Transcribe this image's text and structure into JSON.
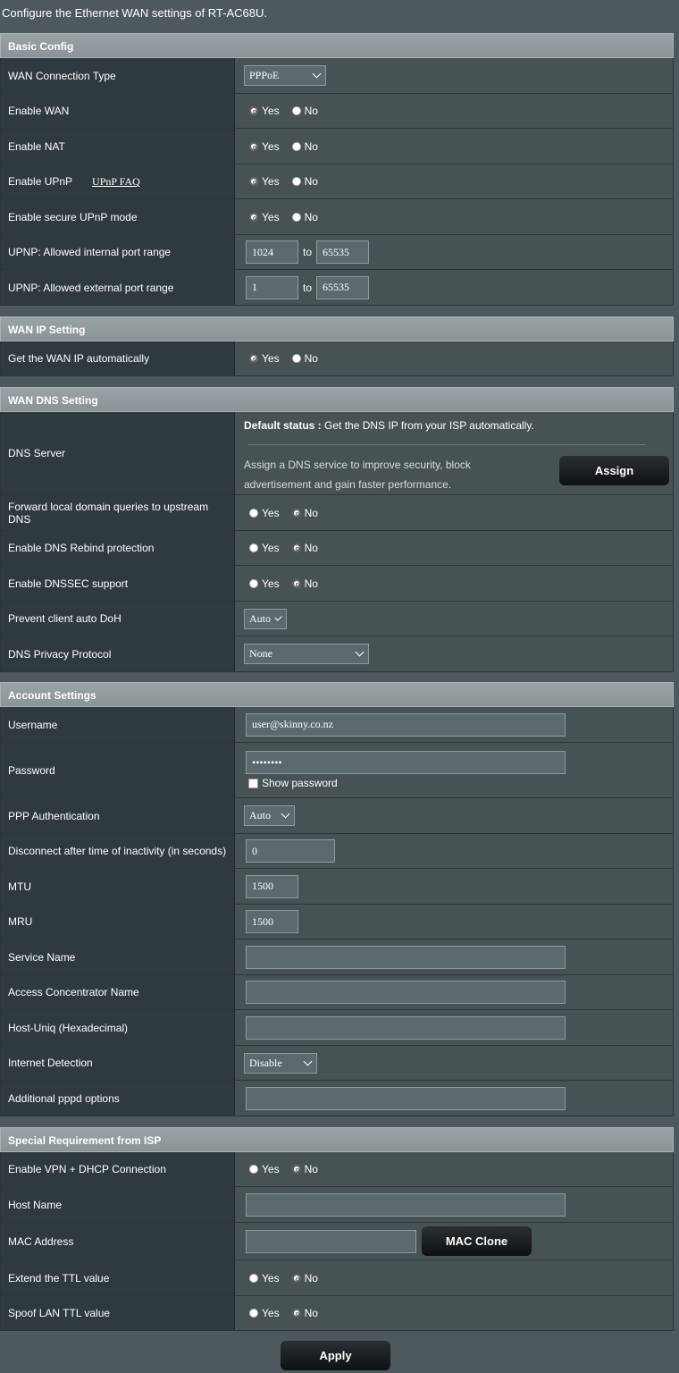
{
  "intro": "Configure the Ethernet WAN settings of RT-AC68U.",
  "yes": "Yes",
  "no": "No",
  "to": "to",
  "basic": {
    "title": "Basic Config",
    "wan_type_label": "WAN Connection Type",
    "wan_type_value": "PPPoE",
    "enable_wan_label": "Enable WAN",
    "enable_nat_label": "Enable NAT",
    "enable_upnp_label": "Enable UPnP",
    "upnp_faq": "UPnP FAQ",
    "secure_upnp_label": "Enable secure UPnP mode",
    "int_range_label": "UPNP: Allowed internal port range",
    "int_from": "1024",
    "int_to": "65535",
    "ext_range_label": "UPNP: Allowed external port range",
    "ext_from": "1",
    "ext_to": "65535"
  },
  "wanip": {
    "title": "WAN IP Setting",
    "auto_label": "Get the WAN IP automatically"
  },
  "dns": {
    "title": "WAN DNS Setting",
    "server_label": "DNS Server",
    "default_status_bold": "Default status :",
    "default_status_text": " Get the DNS IP from your ISP automatically.",
    "assign_text_1": "Assign a DNS service to improve security, block",
    "assign_text_2": "advertisement and gain faster performance.",
    "assign_button": "Assign",
    "forward_label_1": "Forward local domain queries to upstream",
    "forward_label_2": "DNS",
    "rebind_label": "Enable DNS Rebind protection",
    "dnssec_label": "Enable DNSSEC support",
    "doh_label": "Prevent client auto DoH",
    "doh_value": "Auto",
    "privacy_label": "DNS Privacy Protocol",
    "privacy_value": "None"
  },
  "account": {
    "title": "Account Settings",
    "username_label": "Username",
    "username_value": "user@skinny.co.nz",
    "password_label": "Password",
    "password_value": "••••••••",
    "show_password": "Show password",
    "ppp_auth_label": "PPP Authentication",
    "ppp_auth_value": "Auto",
    "idle_label": "Disconnect after time of inactivity (in seconds)",
    "idle_value": "0",
    "mtu_label": "MTU",
    "mtu_value": "1500",
    "mru_label": "MRU",
    "mru_value": "1500",
    "service_label": "Service Name",
    "ac_label": "Access Concentrator Name",
    "hostuniq_label": "Host-Uniq (Hexadecimal)",
    "detect_label": "Internet Detection",
    "detect_value": "Disable",
    "pppd_label": "Additional pppd options"
  },
  "special": {
    "title": "Special Requirement from ISP",
    "vpn_dhcp_label": "Enable VPN + DHCP Connection",
    "hostname_label": "Host Name",
    "mac_label": "MAC Address",
    "mac_clone": "MAC Clone",
    "ttl_label": "Extend the TTL value",
    "spoof_label": "Spoof LAN TTL value"
  },
  "apply": "Apply"
}
